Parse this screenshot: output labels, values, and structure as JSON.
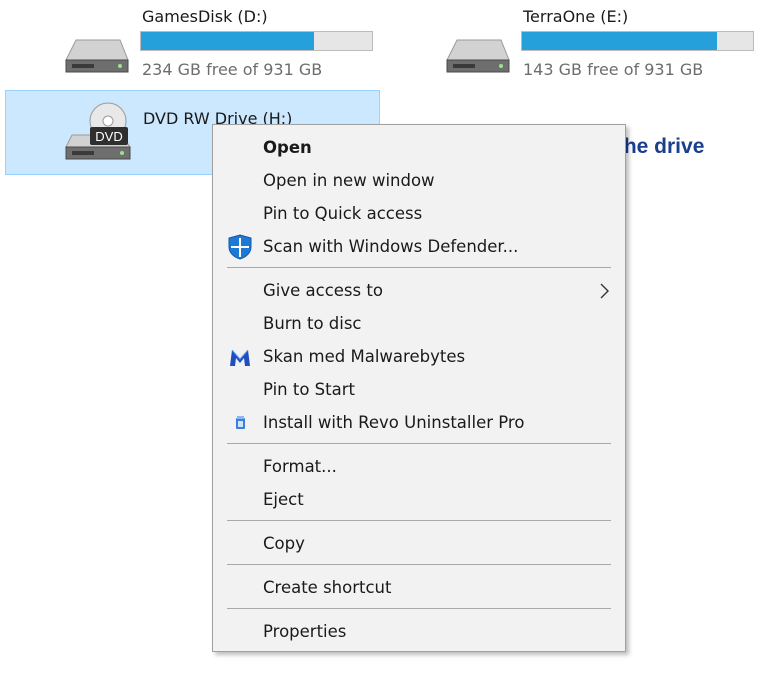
{
  "drives": [
    {
      "id": "drive-d",
      "name": "GamesDisk (D:)",
      "free_text": "234 GB free of 931 GB",
      "used_fraction": 0.749,
      "icon": "hard-drive-icon"
    },
    {
      "id": "drive-e",
      "name": "TerraOne (E:)",
      "free_text": "143 GB free of 931 GB",
      "used_fraction": 0.846,
      "icon": "hard-drive-icon"
    },
    {
      "id": "drive-h",
      "name": "DVD RW Drive (H:)",
      "icon": "dvd-drive-icon",
      "badge": "DVD",
      "selected": true
    }
  ],
  "annotation": "I am trying to open a CD in the drive",
  "context_menu": {
    "items": [
      {
        "label": "Open",
        "bold": true
      },
      {
        "label": "Open in new window"
      },
      {
        "label": "Pin to Quick access"
      },
      {
        "label": "Scan with Windows Defender...",
        "icon": "windows-defender-shield-icon"
      },
      {
        "separator": true
      },
      {
        "label": "Give access to",
        "submenu": true
      },
      {
        "label": "Burn to disc"
      },
      {
        "label": "Skan med Malwarebytes",
        "icon": "malwarebytes-icon"
      },
      {
        "label": "Pin to Start"
      },
      {
        "label": "Install with Revo Uninstaller Pro",
        "icon": "revo-uninstaller-icon"
      },
      {
        "separator": true
      },
      {
        "label": "Format..."
      },
      {
        "label": "Eject"
      },
      {
        "separator": true
      },
      {
        "label": "Copy"
      },
      {
        "separator": true
      },
      {
        "label": "Create shortcut"
      },
      {
        "separator": true
      },
      {
        "label": "Properties"
      }
    ]
  },
  "colors": {
    "accent_bar": "#26a0da",
    "selection_bg": "#cce8ff",
    "selection_border": "#99d1ff",
    "annotation": "#1b3f8f",
    "menu_bg": "#f2f2f2"
  }
}
